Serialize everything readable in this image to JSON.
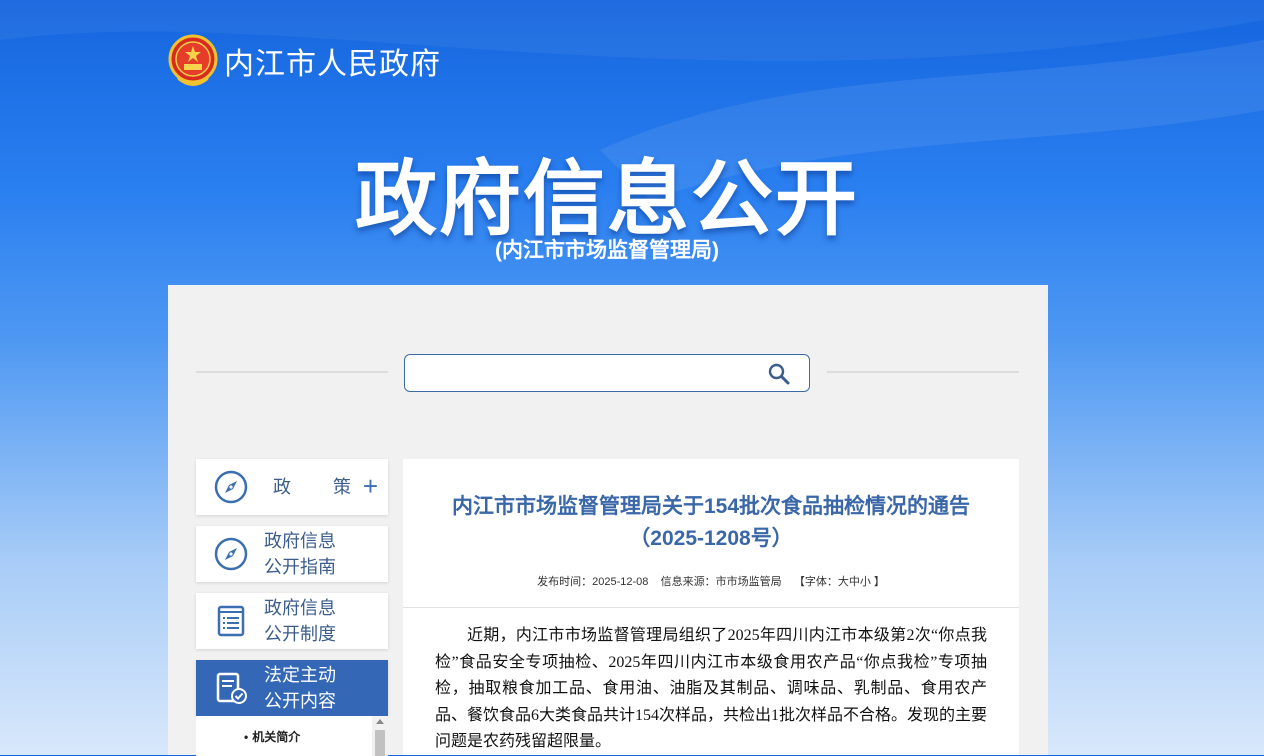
{
  "header": {
    "site_name": "内江市人民政府",
    "emblem_icon": "national-emblem-icon"
  },
  "hero": {
    "title": "政府信息公开",
    "subtitle": "(内江市市场监督管理局)"
  },
  "search": {
    "value": "",
    "icon": "search-icon"
  },
  "sidebar": {
    "items": [
      {
        "label": "政策",
        "icon": "compass-icon",
        "action_icon": "plus-icon",
        "active": false
      },
      {
        "label": "政府信息\n公开指南",
        "icon": "compass-icon",
        "active": false
      },
      {
        "label": "政府信息\n公开制度",
        "icon": "document-list-icon",
        "active": false
      },
      {
        "label": "法定主动\n公开内容",
        "icon": "document-check-icon",
        "active": true
      }
    ],
    "sub_items": [
      "机关简介"
    ]
  },
  "article": {
    "title_line1": "内江市市场监督管理局关于154批次食品抽检情况的通告",
    "title_line2": "（2025-1208号）",
    "meta_publish": "发布时间：2025-12-08",
    "meta_source": "信息来源：市市场监管局",
    "meta_font_prefix": "【字体：",
    "meta_font_large": "大",
    "meta_font_medium": "中",
    "meta_font_small": "小",
    "meta_font_suffix": "】",
    "body": "近期，内江市市场监督管理局组织了2025年四川内江市本级第2次“你点我检”食品安全专项抽检、2025年四川内江市本级食用农产品“你点我检”专项抽检，抽取粮食加工品、食用油、油脂及其制品、调味品、乳制品、食用农产品、餐饮食品6大类食品共计154次样品，共检出1批次样品不合格。发现的主要问题是农药残留超限量。"
  },
  "colors": {
    "accent": "#3468b7",
    "title_blue": "#3a67a8",
    "panel_bg": "#f1f1f1"
  }
}
